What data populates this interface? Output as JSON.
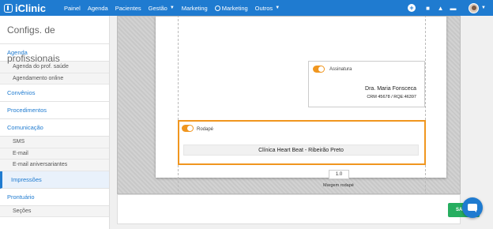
{
  "app": {
    "logo": "iClinic"
  },
  "nav": {
    "items": [
      {
        "label": "Painel"
      },
      {
        "label": "Agenda"
      },
      {
        "label": "Pacientes"
      },
      {
        "label": "Gestão"
      },
      {
        "label": "Marketing"
      },
      {
        "label": "Marketing"
      },
      {
        "label": "Outros"
      }
    ]
  },
  "sidebar": {
    "title": "Configs. de profissionais",
    "sections": [
      {
        "label": "Agenda"
      },
      {
        "label": "Agenda do prof. saúde"
      },
      {
        "label": "Agendamento online"
      },
      {
        "label": "Convênios"
      },
      {
        "label": "Procedimentos"
      },
      {
        "label": "Comunicação"
      },
      {
        "label": "SMS"
      },
      {
        "label": "E-mail"
      },
      {
        "label": "E-mail aniversariantes"
      },
      {
        "label": "Impressões"
      },
      {
        "label": "Prontuário"
      },
      {
        "label": "Seções"
      }
    ]
  },
  "editor": {
    "signature": {
      "toggle_label": "Assinatura",
      "enabled": true,
      "name": "Dra. Maria Fonsceca",
      "crm": "CRM 45678 / RQE:46397"
    },
    "footer": {
      "toggle_label": "Rodapé",
      "enabled": true,
      "text": "Clínica Heart Beat - Ribeirão Preto"
    },
    "margin": {
      "value": "1.0",
      "label": "Margem rodapé"
    }
  },
  "actions": {
    "save_label": "SAL"
  },
  "colors": {
    "brand": "#1f7bd0",
    "accent": "#f0961f",
    "save": "#27ae60"
  }
}
